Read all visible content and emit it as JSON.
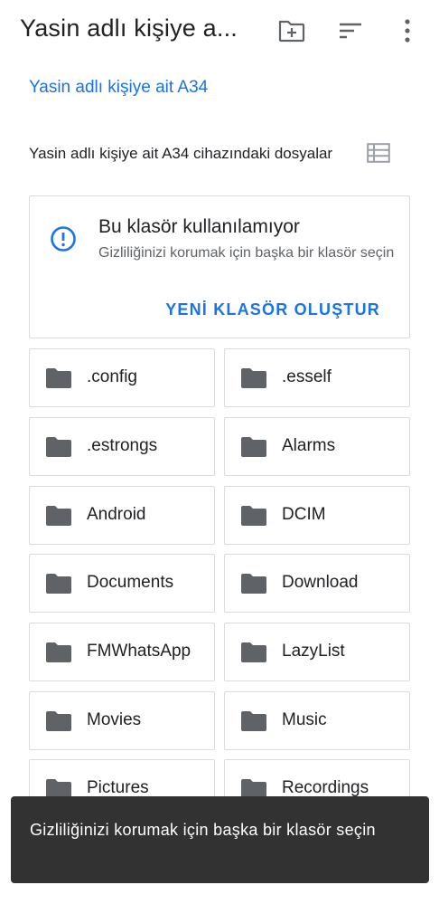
{
  "app_bar": {
    "title": "Yasin adlı kişiye a...",
    "new_folder_icon": "create-new-folder-icon",
    "sort_icon": "sort-icon",
    "more_icon": "more-vert-icon"
  },
  "breadcrumb": {
    "label": "Yasin adlı kişiye ait A34"
  },
  "subheader": {
    "label": "Yasin adlı kişiye ait A34 cihazındaki dosyalar",
    "view_toggle_icon": "list-view-icon"
  },
  "notice": {
    "icon": "info-icon",
    "title": "Bu klasör kullanılamıyor",
    "body": "Gizliliğinizi korumak için başka bir klasör seçin",
    "action": "YENİ KLASÖR OLUŞTUR"
  },
  "folders": [
    {
      "name": ".config"
    },
    {
      "name": ".esself"
    },
    {
      "name": ".estrongs"
    },
    {
      "name": "Alarms"
    },
    {
      "name": "Android"
    },
    {
      "name": "DCIM"
    },
    {
      "name": "Documents"
    },
    {
      "name": "Download"
    },
    {
      "name": "FMWhatsApp"
    },
    {
      "name": "LazyList"
    },
    {
      "name": "Movies"
    },
    {
      "name": "Music"
    },
    {
      "name": "Pictures"
    },
    {
      "name": "Recordings"
    }
  ],
  "snackbar": {
    "message": "Gizliliğinizi korumak için başka bir klasör seçin"
  },
  "colors": {
    "accent": "#1a73e8",
    "folder_icon": "#5f6368",
    "snackbar_bg": "#323232",
    "border": "#dadce0"
  }
}
